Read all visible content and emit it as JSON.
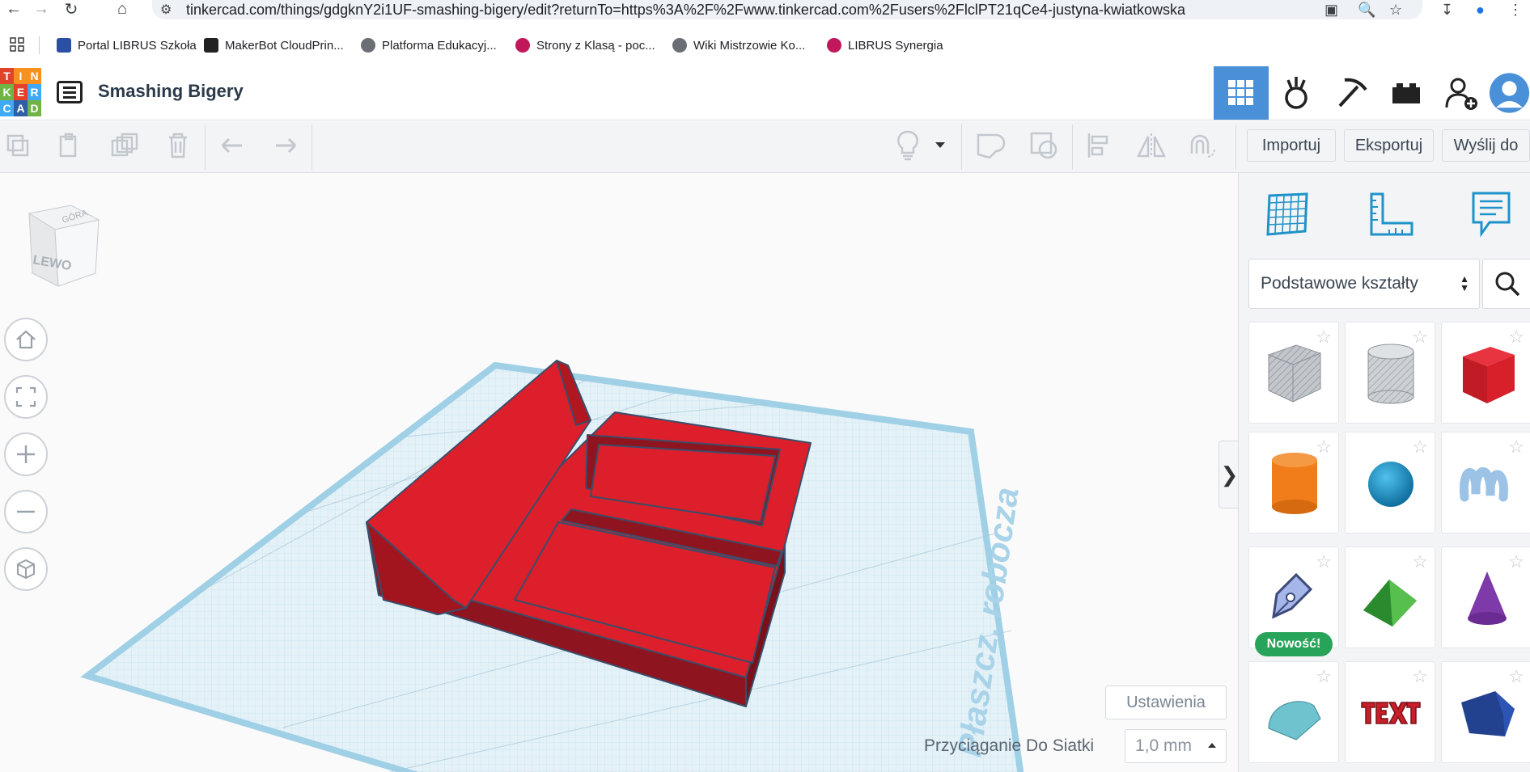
{
  "browser": {
    "url": "tinkercad.com/things/gdgknY2i1UF-smashing-bigery/edit?returnTo=https%3A%2F%2Fwww.tinkercad.com%2Fusers%2FlclPT21qCe4-justyna-kwiatkowska"
  },
  "bookmarks": [
    {
      "label": "Portal LIBRUS Szkoła",
      "color": "#2b4fa3"
    },
    {
      "label": "MakerBot CloudPrin...",
      "color": "#222222"
    },
    {
      "label": "Platforma Edukacyj...",
      "color": "#6b6f75"
    },
    {
      "label": "Strony z Klasą - poc...",
      "color": "#c2185b"
    },
    {
      "label": "Wiki Mistrzowie Ko...",
      "color": "#6b6f75"
    },
    {
      "label": "LIBRUS Synergia",
      "color": "#c2185b"
    }
  ],
  "app": {
    "logo_letters": [
      "T",
      "I",
      "N",
      "K",
      "E",
      "R",
      "C",
      "A",
      "D"
    ],
    "logo_colors": [
      "#e2412b",
      "#f6911e",
      "#f6911e",
      "#6fb444",
      "#e2412b",
      "#3fa9f5",
      "#3fa9f5",
      "#2e5ea8",
      "#6fb444"
    ],
    "project_title": "Smashing Bigery",
    "accent_color": "#4a90d9"
  },
  "toolbar": {
    "import_label": "Importuj",
    "export_label": "Eksportuj",
    "send_label": "Wyślij do"
  },
  "viewport": {
    "view_cube_label": "LEWO",
    "view_cube_top_label": "GÓRA",
    "workplane_label": "Płaszcz. robocza",
    "settings_label": "Ustawienia",
    "snap_label": "Przyciąganie Do Siatki",
    "snap_value": "1,0 mm"
  },
  "panel": {
    "category_value": "Podstawowe kształty",
    "new_badge": "Nowość!",
    "shapes": [
      {
        "name": "box-hole",
        "color": "#a9aeb5"
      },
      {
        "name": "cylinder-hole",
        "color": "#b9bec4"
      },
      {
        "name": "box",
        "color": "#d8202a"
      },
      {
        "name": "cylinder",
        "color": "#f07d1a"
      },
      {
        "name": "sphere",
        "color": "#1e95c9"
      },
      {
        "name": "scribble",
        "color": "#9cc3e6"
      },
      {
        "name": "shape-generator",
        "color": "#a7b6e8"
      },
      {
        "name": "roof",
        "color": "#3aa13a"
      },
      {
        "name": "cone",
        "color": "#7d3aa8"
      },
      {
        "name": "round-roof",
        "color": "#6fc3cf"
      },
      {
        "name": "text",
        "color": "#c81f2a"
      },
      {
        "name": "polygon",
        "color": "#22418f"
      }
    ]
  }
}
